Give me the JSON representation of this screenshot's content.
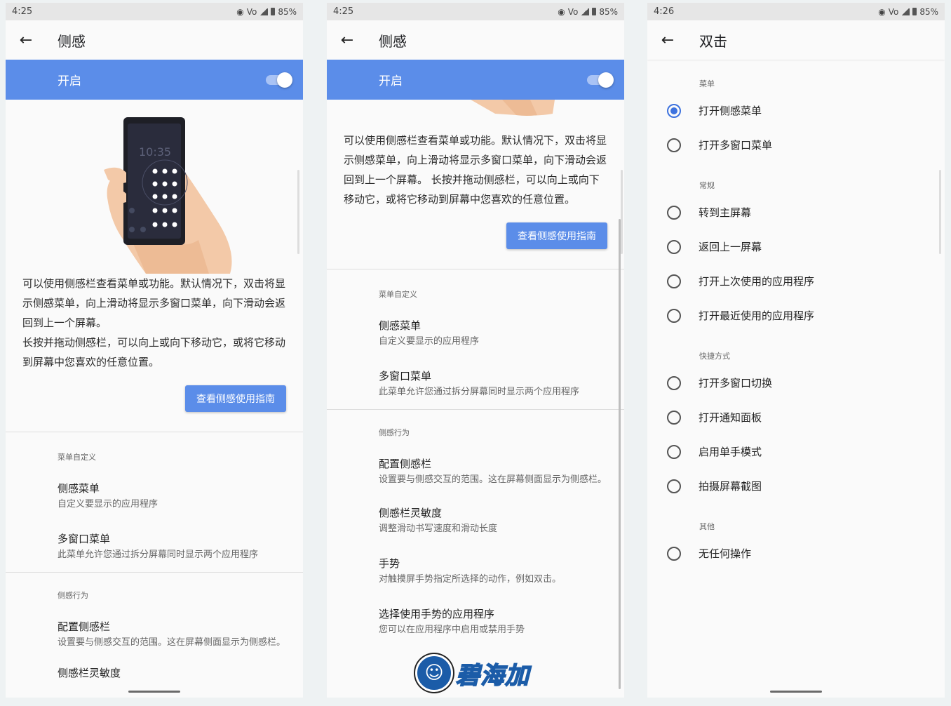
{
  "status": {
    "p1_time": "4:25",
    "p2_time": "4:25",
    "p3_time": "4:26",
    "volte": "Vo",
    "battery": "85%"
  },
  "panel1": {
    "title": "侧感",
    "master_label": "开启",
    "phone_clock": "10:35",
    "description": "可以使用侧感栏查看菜单或功能。默认情况下，双击将显示侧感菜单，向上滑动将显示多窗口菜单，向下滑动会返回到上一个屏幕。\n长按并拖动侧感栏，可以向上或向下移动它，或将它移动到屏幕中您喜欢的任意位置。",
    "guide_button": "查看侧感使用指南",
    "section_menu": "菜单自定义",
    "items_menu": [
      {
        "title": "侧感菜单",
        "summary": "自定义要显示的应用程序"
      },
      {
        "title": "多窗口菜单",
        "summary": "此菜单允许您通过拆分屏幕同时显示两个应用程序"
      }
    ],
    "section_behavior": "侧感行为",
    "items_behavior": [
      {
        "title": "配置侧感栏",
        "summary": "设置要与侧感交互的范围。这在屏幕侧面显示为侧感栏。"
      },
      {
        "title": "侧感栏灵敏度"
      }
    ]
  },
  "panel2": {
    "title": "侧感",
    "master_label": "开启",
    "description": "可以使用侧感栏查看菜单或功能。默认情况下，双击将显示侧感菜单，向上滑动将显示多窗口菜单，向下滑动会返回到上一个屏幕。\n长按并拖动侧感栏，可以向上或向下移动它，或将它移动到屏幕中您喜欢的任意位置。",
    "guide_button": "查看侧感使用指南",
    "section_menu": "菜单自定义",
    "items_menu": [
      {
        "title": "侧感菜单",
        "summary": "自定义要显示的应用程序"
      },
      {
        "title": "多窗口菜单",
        "summary": "此菜单允许您通过拆分屏幕同时显示两个应用程序"
      }
    ],
    "section_behavior": "侧感行为",
    "items_behavior": [
      {
        "title": "配置侧感栏",
        "summary": "设置要与侧感交互的范围。这在屏幕侧面显示为侧感栏。"
      },
      {
        "title": "侧感栏灵敏度",
        "summary": "调整滑动书写速度和滑动长度"
      },
      {
        "title": "手势",
        "summary": "对触摸屏手势指定所选择的动作，例如双击。"
      },
      {
        "title": "选择使用手势的应用程序",
        "summary": "您可以在应用程序中启用或禁用手势"
      }
    ]
  },
  "panel3": {
    "title": "双击",
    "groups": [
      {
        "header": "菜单",
        "options": [
          "打开侧感菜单",
          "打开多窗口菜单"
        ]
      },
      {
        "header": "常规",
        "options": [
          "转到主屏幕",
          "返回上一屏幕",
          "打开上次使用的应用程序",
          "打开最近使用的应用程序"
        ]
      },
      {
        "header": "快捷方式",
        "options": [
          "打开多窗口切换",
          "打开通知面板",
          "启用单手模式",
          "拍摄屏幕截图"
        ]
      },
      {
        "header": "其他",
        "options": [
          "无任何操作"
        ]
      }
    ],
    "selected_option": "打开侧感菜单"
  },
  "watermark": {
    "text": "碧海加"
  },
  "colors": {
    "accent": "#5b8de9",
    "radio_selected": "#3d72de",
    "background": "#fafafa"
  }
}
